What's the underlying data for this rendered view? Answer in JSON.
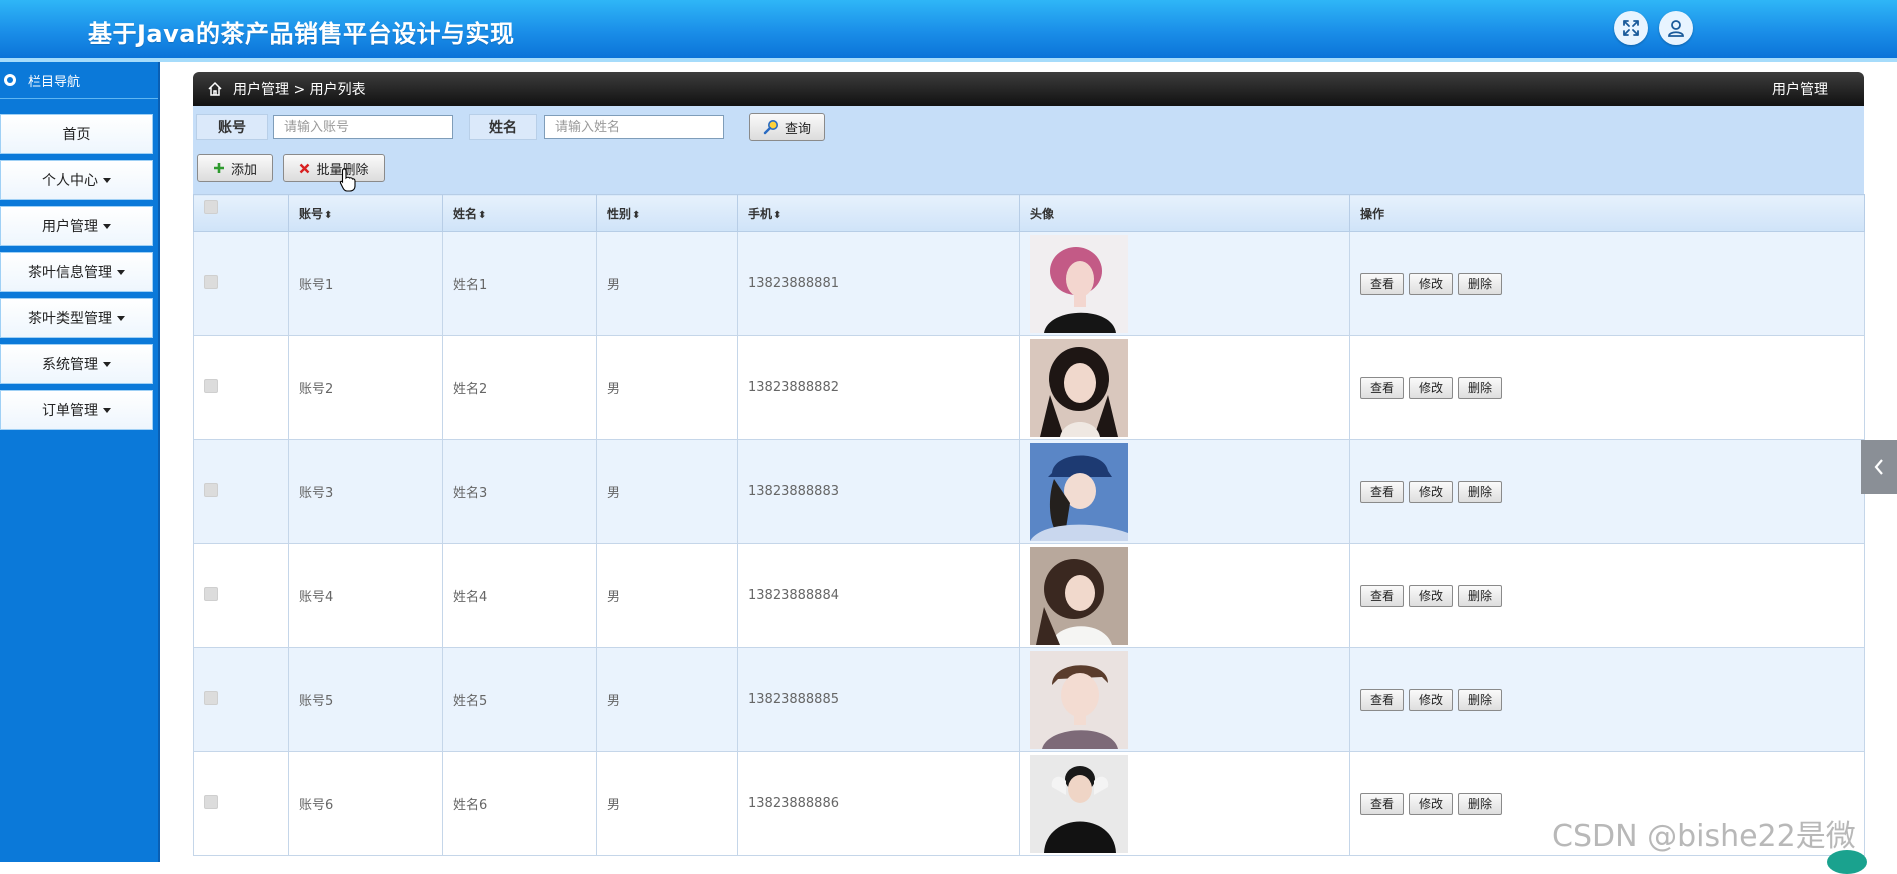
{
  "header": {
    "title": "基于Java的茶产品销售平台设计与实现",
    "icons": [
      "fullscreen-icon",
      "user-icon"
    ]
  },
  "sidebar": {
    "heading": "栏目导航",
    "items": [
      {
        "label": "首页",
        "dropdown": false
      },
      {
        "label": "个人中心",
        "dropdown": true
      },
      {
        "label": "用户管理",
        "dropdown": true
      },
      {
        "label": "茶叶信息管理",
        "dropdown": true
      },
      {
        "label": "茶叶类型管理",
        "dropdown": true
      },
      {
        "label": "系统管理",
        "dropdown": true
      },
      {
        "label": "订单管理",
        "dropdown": true
      }
    ]
  },
  "breadcrumb": {
    "path": "用户管理 > 用户列表",
    "right_label": "用户管理"
  },
  "search": {
    "account_label": "账号",
    "account_placeholder": "请输入账号",
    "name_label": "姓名",
    "name_placeholder": "请输入姓名",
    "query_label": "查询"
  },
  "actions": {
    "add_label": "添加",
    "batch_delete_label": "批量删除"
  },
  "table": {
    "columns": [
      "账号",
      "姓名",
      "性别",
      "手机",
      "头像",
      "操作"
    ],
    "row_buttons": [
      "查看",
      "修改",
      "删除"
    ],
    "rows": [
      {
        "account": "账号1",
        "name": "姓名1",
        "gender": "男",
        "phone": "13823888881"
      },
      {
        "account": "账号2",
        "name": "姓名2",
        "gender": "男",
        "phone": "13823888882"
      },
      {
        "account": "账号3",
        "name": "姓名3",
        "gender": "男",
        "phone": "13823888883"
      },
      {
        "account": "账号4",
        "name": "姓名4",
        "gender": "男",
        "phone": "13823888884"
      },
      {
        "account": "账号5",
        "name": "姓名5",
        "gender": "男",
        "phone": "13823888885"
      },
      {
        "account": "账号6",
        "name": "姓名6",
        "gender": "男",
        "phone": "13823888886"
      }
    ]
  },
  "watermark": "CSDN @bishe22是微",
  "colors": {
    "header_blue": "#1a8ee8",
    "sidebar_blue": "#0b79d9",
    "toolbar_bg": "#c6def8",
    "row_alt": "#eaf3fd"
  }
}
